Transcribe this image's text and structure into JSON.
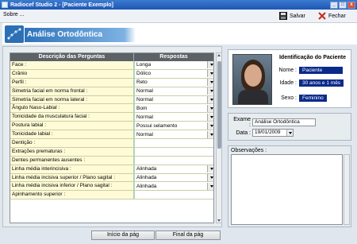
{
  "window": {
    "title": "Radiocef Studio 2 - [Paciente Exemplo]"
  },
  "menu": {
    "label": "Sobre ..."
  },
  "toolbar": {
    "save_label": "Salvar",
    "close_label": "Fechar"
  },
  "header": {
    "title": "Análise Ortodôntica"
  },
  "grid": {
    "col_questions": "Descrição das Perguntas",
    "col_answers": "Respostas",
    "rows": [
      {
        "q": "Face :",
        "a": "Longa"
      },
      {
        "q": "Crânio",
        "a": "Dólico"
      },
      {
        "q": "Perfil :",
        "a": "Reto"
      },
      {
        "q": "Simetria facial em norma frontal :",
        "a": "Normal"
      },
      {
        "q": "Simetria facial em norma lateral :",
        "a": "Normal"
      },
      {
        "q": "Ângulo Naso-Labial :",
        "a": "Bom"
      },
      {
        "q": "Tonicidade da musculatura facial :",
        "a": "Normal"
      },
      {
        "q": "Postura labial :",
        "a": "Possui selamento"
      },
      {
        "q": "Tonicidade labial :",
        "a": "Normal"
      },
      {
        "q": "Dentição :",
        "a": ""
      },
      {
        "q": "Extrações prematuras :",
        "a": ""
      },
      {
        "q": "Dentes permanentes ausentes :",
        "a": ""
      },
      {
        "q": "Linha média interincisiva :",
        "a": "Alinhada"
      },
      {
        "q": "Linha média incisiva superior / Plano sagital :",
        "a": "Alinhada"
      },
      {
        "q": "Linha média incisiva inferior / Plano sagital :",
        "a": "Alinhada"
      },
      {
        "q": "Apinhamento superior :",
        "a": ""
      }
    ]
  },
  "nav": {
    "start_label": "Início da pág",
    "end_label": "Final da pág"
  },
  "patient": {
    "title": "Identificação do Paciente",
    "name_label": "Nome :",
    "name_value": "Paciente",
    "age_label": "Idade :",
    "age_value": "30 anos e 1 mês",
    "sex_label": "Sexo :",
    "sex_value": "Feminino"
  },
  "exam": {
    "exam_label": "Exame :",
    "exam_value": "Análise Ortodôntica",
    "date_label": "Data :",
    "date_value": "19/01/2009"
  },
  "observations": {
    "label": "Observações :",
    "value": ""
  },
  "colors": {
    "title_bar": "#1d56b5",
    "header_blue": "#2c73bb",
    "badge": "#0b2a8a",
    "question_bg": "#fffbd7"
  }
}
